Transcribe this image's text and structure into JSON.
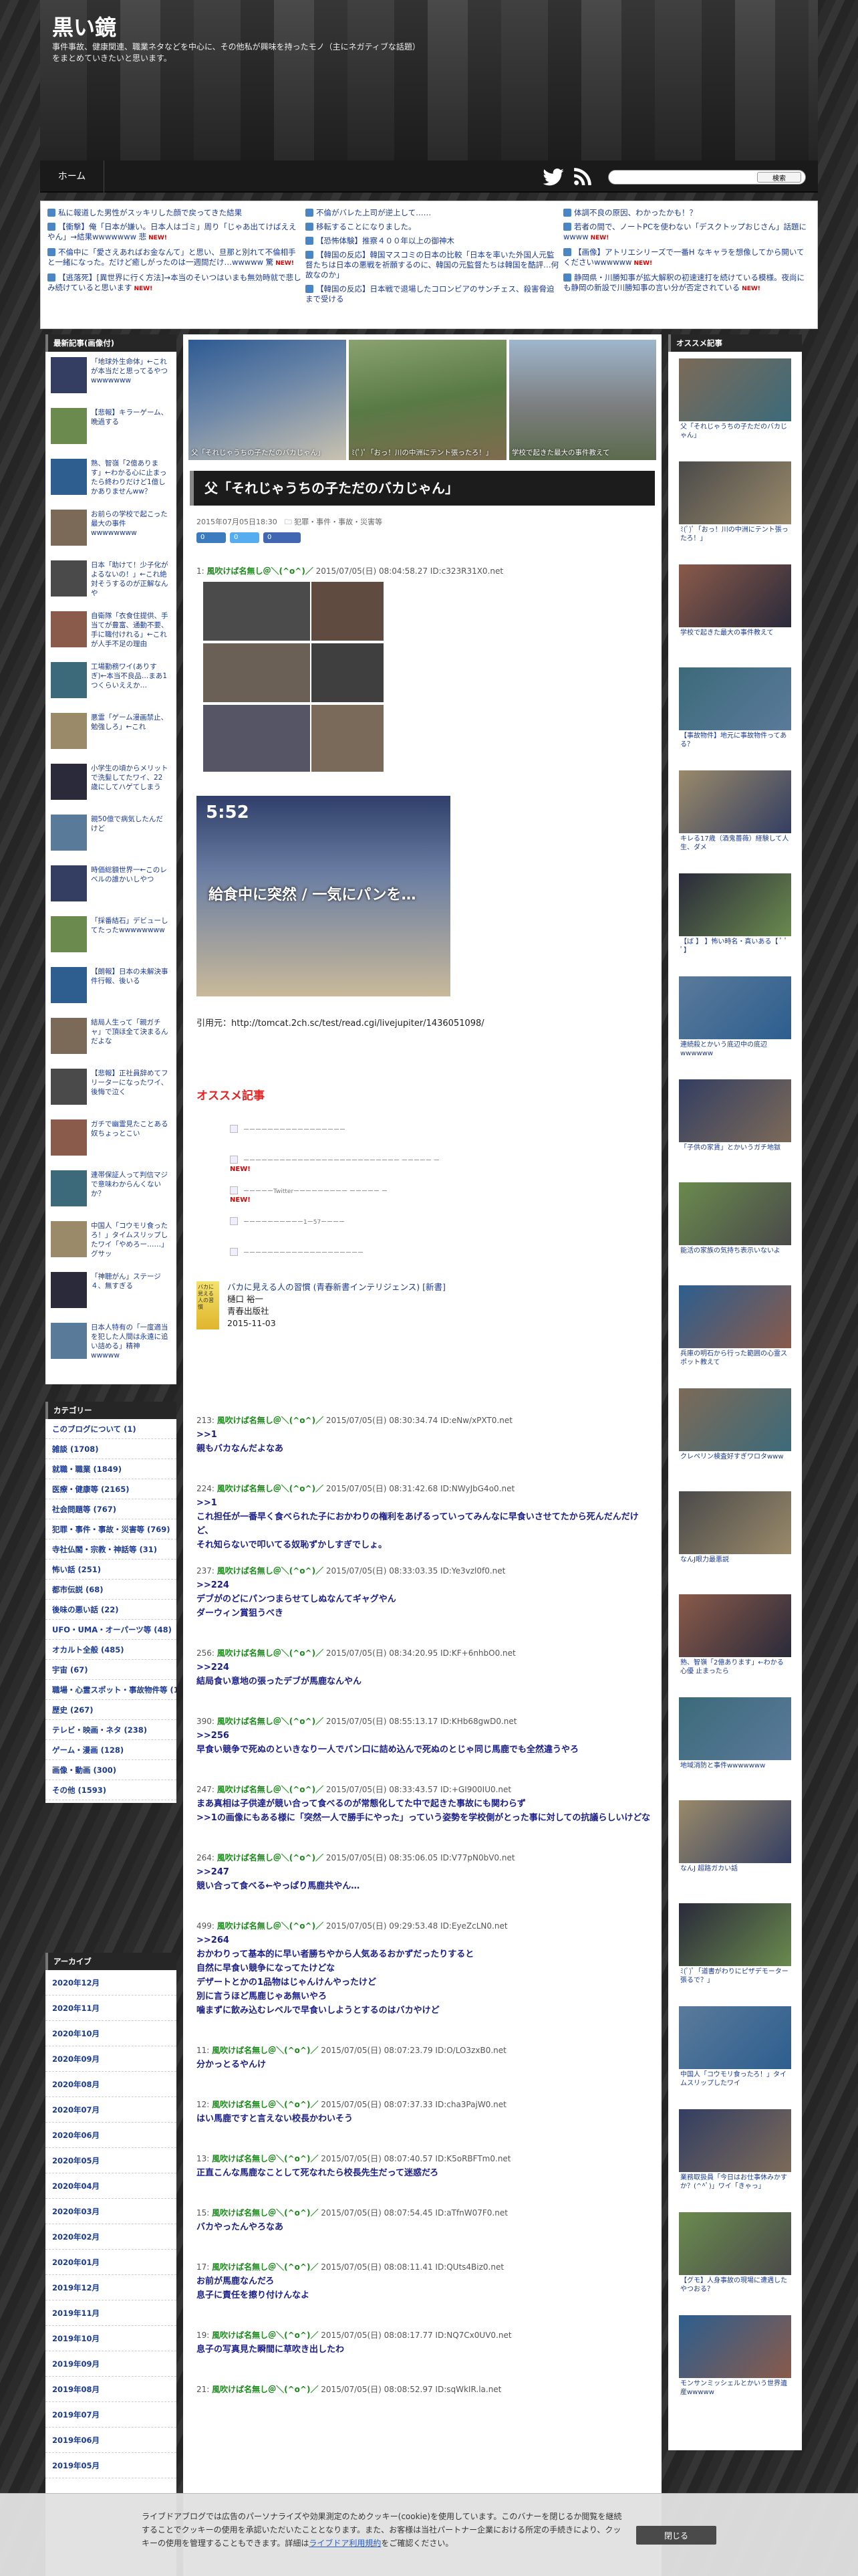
{
  "header": {
    "title": "黒い鏡",
    "description": "事件事故、健康関連、職業ネタなどを中心に、その他私が興味を持ったモノ（主にネガティブな話題）をまとめていきたいと思います。"
  },
  "nav": {
    "home": "ホーム",
    "search_button": "検索"
  },
  "news": {
    "col1": [
      {
        "text": "私に報道した男性がスッキリした顔で戻ってきた結果",
        "new": ""
      },
      {
        "text": "【衝撃】俺「日本が嫌い。日本人はゴミ」周り「じゃあ出てけばええやん」→結果wwwwwww 悲",
        "new": "NEW!"
      },
      {
        "text": "不倫中に「愛さえあればお金なんて」と思い、旦那と別れて不倫相手と一緒になった。だけど癒しがったのは一週間だけ…wwwww 驚",
        "new": "NEW!"
      },
      {
        "text": "【逃落死】[異世界に行く方法]→本当のそいつはいまも無効時就で悲しみ続けていると思います",
        "new": "NEW!"
      }
    ],
    "col2": [
      {
        "text": "不倫がバレた上司が逆上して……",
        "new": ""
      },
      {
        "text": "移転することになりました。",
        "new": ""
      },
      {
        "text": "【恐怖体験】推察４００年以上の御神木",
        "new": ""
      },
      {
        "text": "【韓国の反応】韓国マスコミの日本の比較「日本を率いた外国人元監督たちは日本の悪戦を祈願するのに、韓国の元監督たちは韓国を酷評…何故なのか」",
        "new": ""
      },
      {
        "text": "【韓国の反応】日本戦で退場したコロンビアのサンチェス、殺害脅迫まで受ける",
        "new": ""
      }
    ],
    "col3": [
      {
        "text": "体調不良の原因、わかったかも！？",
        "new": ""
      },
      {
        "text": "若者の間で、ノートPCを使わない「デスクトップおじさん」話題にwwww",
        "new": "NEW!"
      },
      {
        "text": "【画像】アトリエシリーズで一番H なキャラを想像してから開いてくださいwwwwww",
        "new": "NEW!"
      },
      {
        "text": "静岡県・川勝知事が拡大解釈の初速速打を続けている模様。夜尚にも静岡の新設で川勝知事の言い分が否定されている",
        "new": "NEW!"
      }
    ]
  },
  "left": {
    "recent_header": "最新記事(画像付)",
    "recent": [
      "「地球外生命体」←これが本当だと思ってるやつwwwwwww",
      "【悲報】キラーゲーム、晩過する",
      "熟、智嶺「2億あります」←わかる心に止まったら終わりだけど1億しかありませんww？",
      "お前らの学校で起こった最大の事件wwwwwwww",
      "日本「助けて！少子化がよるないの！」←これ絶対そうするのが正解なんや",
      "自衛隊「衣食住提供、手当てが豊富、通勤不要、手に職付けれる」←これが人手不足の理由",
      "工場勤務ワイ(ありすぎ)←本当不良品…まあ1つくらいええか…",
      "悪霊「ゲーム漫画禁止、勉強しろ」←これ",
      "小学生の頃からメリットで洗髪してたワイ、22歳にしてハゲてしまう",
      "親50億で病気したんだけど",
      "時価総額世界一←このレベルの誰かいしやつ",
      "「採番結石」デビューしてたったwwwwwwww",
      "【朗報】日本の未解決事件行報、後いる",
      "結局人生って「親ガチャ」で頂ほ全て決まるんだよな",
      "【悲報】正社員辞めてフリーターになったワイ、後悔で泣く",
      "ガチで幽霊見たことある奴ちょっとこい",
      "連帯保証人って判信マジで意味わからんくないか？",
      "中国人「コウモリ食ったろ！」タイムスリップしたワイ「やめろー……」グサッ",
      "「神聴がん」ステージ４、無すぎる",
      "日本人特有の「一度適当を犯した人間は永遠に追い詰める」精神wwwww"
    ],
    "categories_header": "カテゴリー",
    "categories": [
      "このブログについて (1)",
      "雑談 (1708)",
      "就職・職業 (1849)",
      "医療・健康等 (2165)",
      "社会問題等 (767)",
      "犯罪・事件・事故・災害等 (769)",
      "寺社仏閣・宗教・神話等 (31)",
      "怖い話 (251)",
      "都市伝説 (68)",
      "後味の悪い話 (22)",
      "UFO・UMA・オーパーツ等 (48)",
      "オカルト全般 (485)",
      "宇宙 (67)",
      "職場・心霊スポット・事故物件等 (115)",
      "歴史 (267)",
      "テレビ・映画・ネタ (238)",
      "ゲーム・漫画 (128)",
      "画像・動画 (300)",
      "その他 (1593)"
    ],
    "archive_header": "アーカイブ",
    "archives": [
      "2020年12月",
      "2020年11月",
      "2020年10月",
      "2020年09月",
      "2020年08月",
      "2020年07月",
      "2020年06月",
      "2020年05月",
      "2020年04月",
      "2020年03月",
      "2020年02月",
      "2020年01月",
      "2019年12月",
      "2019年11月",
      "2019年10月",
      "2019年09月",
      "2019年08月",
      "2019年07月",
      "2019年06月",
      "2019年05月"
    ]
  },
  "slider": [
    {
      "caption": "父「それじゃうちの子ただのバカじゃん」"
    },
    {
      "caption": "ﾐ(ﾟ)ﾟ「おっ！川の中洲にテント張ったろ！」"
    },
    {
      "caption": "学校で起きた最大の事件教えて"
    }
  ],
  "post": {
    "title": "父「それじゃうちの子ただのバカじゃん」",
    "meta": "2015年07月05日18:30　🗀 犯罪・事件・事故・災害等",
    "share": [
      "0",
      "0",
      "0"
    ],
    "first": {
      "head": "1: ",
      "name": "風吹けば名無し＠＼(^o^)／",
      "rest": " 2015/07/05(日) 08:04:58.27 ID:c323R31X0.net"
    },
    "overlay_time": "5:52",
    "overlay_text": "給食中に突然 / 一気にパンを…",
    "source": "引用元：http://tomcat.2ch.sc/test/read.cgi/livejupiter/1436051098/",
    "recommend_title": "オススメ記事",
    "recommend": [
      {
        "text": "ーーーーーーーーーーーーーーーーー",
        "new": ""
      },
      {
        "text": "ーーーーーーーーーーーーーーーーーーーーーーーーーー ーーーーー ー",
        "new": "NEW!"
      },
      {
        "text": "ーーーーーTwitterーーーーーーーーー ーーーーー ー",
        "new": "NEW!"
      },
      {
        "text": "ーーーーーーーーーー1ー57ーーーー",
        "new": ""
      },
      {
        "text": "ーーーーーーーーーーーーーーーーーーーー",
        "new": ""
      }
    ],
    "book": {
      "title": "バカに見える人の習慣 (青春新書インテリジェンス) [新書]",
      "author": "樋口 裕一",
      "publisher": "青春出版社",
      "date": "2015-11-03",
      "cover": "バカに見える人の習慣"
    },
    "comments": [
      {
        "num": "213: ",
        "name": "風吹けば名無し＠＼(^o^)／",
        "rest": " 2015/07/05(日) 08:30:34.74 ID:eNw/xPXT0.net",
        "lines": [
          ">>1",
          "親もバカなんだよなあ"
        ]
      },
      {
        "num": "224: ",
        "name": "風吹けば名無し＠＼(^o^)／",
        "rest": " 2015/07/05(日) 08:31:42.68 ID:NWyJbG4o0.net",
        "lines": [
          ">>1",
          "これ担任が一番早く食べられた子におかわりの権利をあげるっていってみんなに早食いさせてたから死んだんだけど、",
          "それ知らないで叩いてる奴恥ずかしすぎでしょ。"
        ]
      },
      {
        "num": "237: ",
        "name": "風吹けば名無し＠＼(^o^)／",
        "rest": " 2015/07/05(日) 08:33:03.35 ID:Ye3vzl0f0.net",
        "lines": [
          ">>224",
          "デブがのどにパンつまらせてしぬなんてギャグやん",
          "ダーウィン賞狙うべき"
        ]
      },
      {
        "num": "256: ",
        "name": "風吹けば名無し＠＼(^o^)／",
        "rest": " 2015/07/05(日) 08:34:20.95 ID:KF+6nhbO0.net",
        "lines": [
          ">>224",
          "結局食い意地の張ったデブが馬鹿なんやん"
        ]
      },
      {
        "num": "390: ",
        "name": "風吹けば名無し＠＼(^o^)／",
        "rest": " 2015/07/05(日) 08:55:13.17 ID:KHb68gwD0.net",
        "lines": [
          ">>256",
          "早食い競争で死ぬのといきなり一人でパン口に詰め込んで死ぬのとじゃ同じ馬鹿でも全然違うやろ"
        ]
      },
      {
        "num": "247: ",
        "name": "風吹けば名無し＠＼(^o^)／",
        "rest": " 2015/07/05(日) 08:33:43.57 ID:+GI900IU0.net",
        "lines": [
          "まあ真相は子供達が競い合って食べるのが常態化してた中で起きた事故にも関わらず",
          ">>1の画像にもある様に「突然一人で勝手にやった」っていう姿勢を学校側がとった事に対しての抗議らしいけどな"
        ]
      },
      {
        "num": "264: ",
        "name": "風吹けば名無し＠＼(^o^)／",
        "rest": " 2015/07/05(日) 08:35:06.05 ID:V77pN0bV0.net",
        "lines": [
          ">>247",
          "競い合って食べる←やっぱり馬鹿共やん…"
        ]
      },
      {
        "num": "499: ",
        "name": "風吹けば名無し＠＼(^o^)／",
        "rest": " 2015/07/05(日) 09:29:53.48 ID:EyeZcLN0.net",
        "lines": [
          ">>264",
          "おかわりって基本的に早い者勝ちやから人気あるおかずだったりすると",
          "自然に早食い競争になってたけどな",
          "デザートとかの1品物はじゃんけんやったけど",
          "別に言うほど馬鹿じゃあ無いやろ",
          "噛まずに飲み込むレベルで早食いしようとするのはバカやけど"
        ]
      },
      {
        "num": "11: ",
        "name": "風吹けば名無し＠＼(^o^)／",
        "rest": " 2015/07/05(日) 08:07:23.79 ID:O/LO3zxB0.net",
        "lines": [
          "分かっとるやんけ"
        ]
      },
      {
        "num": "12: ",
        "name": "風吹けば名無し＠＼(^o^)／",
        "rest": " 2015/07/05(日) 08:07:37.33 ID:cha3PajW0.net",
        "lines": [
          "はい馬鹿ですと言えない校長かわいそう"
        ]
      },
      {
        "num": "13: ",
        "name": "風吹けば名無し＠＼(^o^)／",
        "rest": " 2015/07/05(日) 08:07:40.57 ID:K5oRBFTm0.net",
        "lines": [
          "正直こんな馬鹿なことして死なれたら校長先生だって迷惑だろ"
        ]
      },
      {
        "num": "15: ",
        "name": "風吹けば名無し＠＼(^o^)／",
        "rest": " 2015/07/05(日) 08:07:54.45 ID:aTfnW07F0.net",
        "lines": [
          "バカやったんやろなあ"
        ]
      },
      {
        "num": "17: ",
        "name": "風吹けば名無し＠＼(^o^)／",
        "rest": " 2015/07/05(日) 08:08:11.41 ID:QUts4Biz0.net",
        "lines": [
          "お前が馬鹿なんだろ",
          "息子に責任を擦り付けんなよ"
        ]
      },
      {
        "num": "19: ",
        "name": "風吹けば名無し＠＼(^o^)／",
        "rest": " 2015/07/05(日) 08:08:17.77 ID:NQ7Cx0UV0.net",
        "lines": [
          "息子の写真見た瞬間に草吹き出したわ"
        ]
      },
      {
        "num": "21: ",
        "name": "風吹けば名無し＠＼(^o^)／",
        "rest": " 2015/07/05(日) 08:08:52.97 ID:sqWkIR.la.net",
        "lines": []
      }
    ]
  },
  "right": {
    "header": "オススメ記事",
    "cards": [
      "父「それじゃうちの子ただのバカじゃん」",
      "ﾐ(ﾟ)ﾟ「おっ！川の中洲にテント張ったろ！」",
      "学校で起きた最大の事件教えて",
      "【事故物件】地元に事故物件ってある？",
      "キレる17歳（酒鬼薔薇）経験して人生、ダメ",
      "【ば 】 】怖い時名・真いある【 ﾟ ﾟ ﾟ】",
      "連続殺とかいう底辺中の底辺wwwwww",
      "「子供の家賃」とかいうガチ地獄",
      "能活の家族の気持ち表示いないよ",
      "兵庫の明石から行った範囲の心霊スポット教えて",
      "クレペリン検査好すぎワロタwww",
      "なんJ眼力最悪説",
      "熟、智嶺「2億あります」←わかる心優 止まったら",
      "地域消防と事件wwwwwww",
      "なんJ 超路ガカい話",
      "ﾐ(ﾟ)ﾟ「道書がわりにピザデモーター張るで？」",
      "中国人「コウモリ食ったろ！」タイムスリップしたワイ",
      "業務取扱員「今日はお仕事休みかすか？(^^ﾟ)」ワイ「きゃっ」",
      "【グモ】人身事故の現場に遭遇したやつおる？",
      "モンサンミッシェルとかいう世界遺産wwwww"
    ]
  },
  "cookie": {
    "text": "ライブドアブログでは広告のパーソナライズや効果測定のためクッキー(cookie)を使用しています。このバナーを閉じるか閲覧を継続することでクッキーの使用を承認いただいたこととなります。また、お客様は当社パートナー企業における所定の手続きにより、クッキーの使用を管理することもできます。詳細は",
    "link": "ライブドア利用規約",
    "tail": "をご確認ください。",
    "button": "閉じる"
  }
}
